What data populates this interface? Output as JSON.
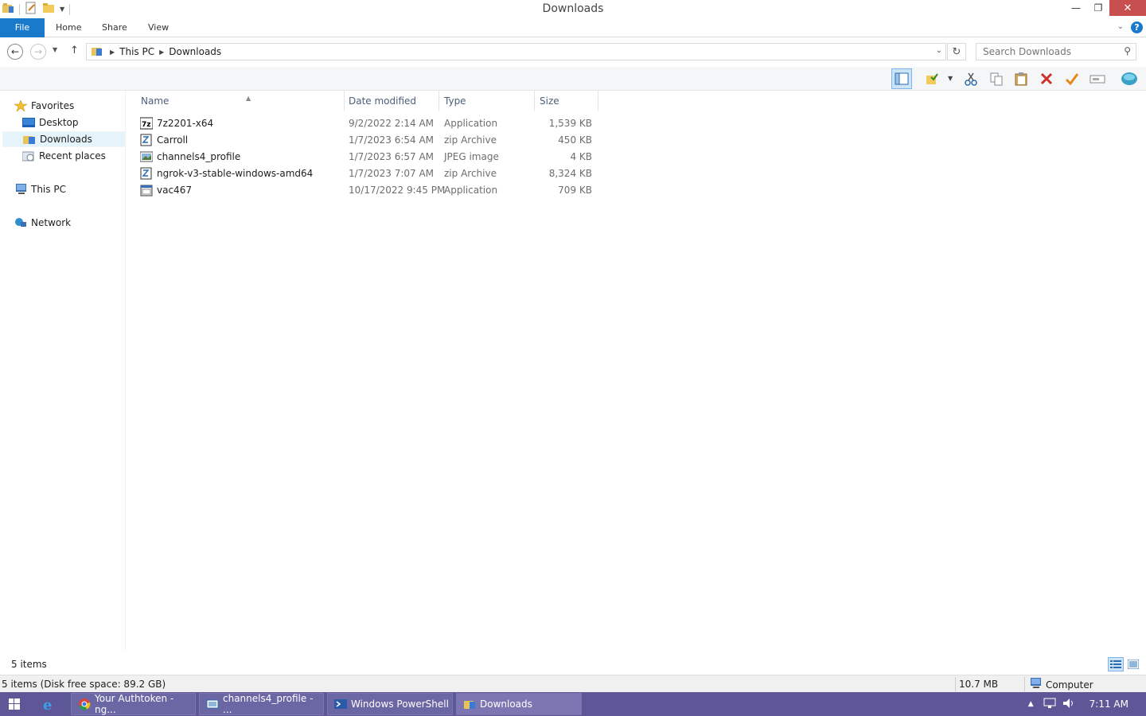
{
  "window": {
    "title": "Downloads",
    "controls": {
      "minimize": "—",
      "restore": "❐",
      "close": "✕"
    }
  },
  "ribbon": {
    "tabs": [
      {
        "label": "File"
      },
      {
        "label": "Home"
      },
      {
        "label": "Share"
      },
      {
        "label": "View"
      }
    ],
    "help": "?"
  },
  "address": {
    "crumbs": [
      "This PC",
      "Downloads"
    ],
    "search_placeholder": "Search Downloads"
  },
  "nav_pane": {
    "favorites": "Favorites",
    "desktop": "Desktop",
    "downloads": "Downloads",
    "recent_places": "Recent places",
    "this_pc": "This PC",
    "network": "Network"
  },
  "columns": {
    "name": "Name",
    "date_modified": "Date modified",
    "type": "Type",
    "size": "Size"
  },
  "files": [
    {
      "name": "7z2201-x64",
      "date": "9/2/2022 2:14 AM",
      "type": "Application",
      "size": "1,539 KB",
      "icon": "app-7z-icon"
    },
    {
      "name": "Carroll",
      "date": "1/7/2023 6:54 AM",
      "type": "zip Archive",
      "size": "450 KB",
      "icon": "zip-icon"
    },
    {
      "name": "channels4_profile",
      "date": "1/7/2023 6:57 AM",
      "type": "JPEG image",
      "size": "4 KB",
      "icon": "image-icon"
    },
    {
      "name": "ngrok-v3-stable-windows-amd64",
      "date": "1/7/2023 7:07 AM",
      "type": "zip Archive",
      "size": "8,324 KB",
      "icon": "zip-icon"
    },
    {
      "name": "vac467",
      "date": "10/17/2022 9:45 PM",
      "type": "Application",
      "size": "709 KB",
      "icon": "app-icon"
    }
  ],
  "status": {
    "items_count": "5 items"
  },
  "details_bar": {
    "summary": "5 items (Disk free space: 89.2 GB)",
    "size": "10.7 MB",
    "location": "Computer"
  },
  "taskbar": {
    "tasks": [
      {
        "label": "Your Authtoken - ng...",
        "icon": "chrome-icon"
      },
      {
        "label": "channels4_profile - ...",
        "icon": "photo-viewer-icon"
      },
      {
        "label": "Windows PowerShell",
        "icon": "powershell-icon"
      },
      {
        "label": "Downloads",
        "icon": "folder-icon"
      }
    ],
    "clock": "7:11 AM"
  },
  "colors": {
    "accent": "#1979ca",
    "taskbar": "#5d5797",
    "close": "#c74f4f"
  }
}
